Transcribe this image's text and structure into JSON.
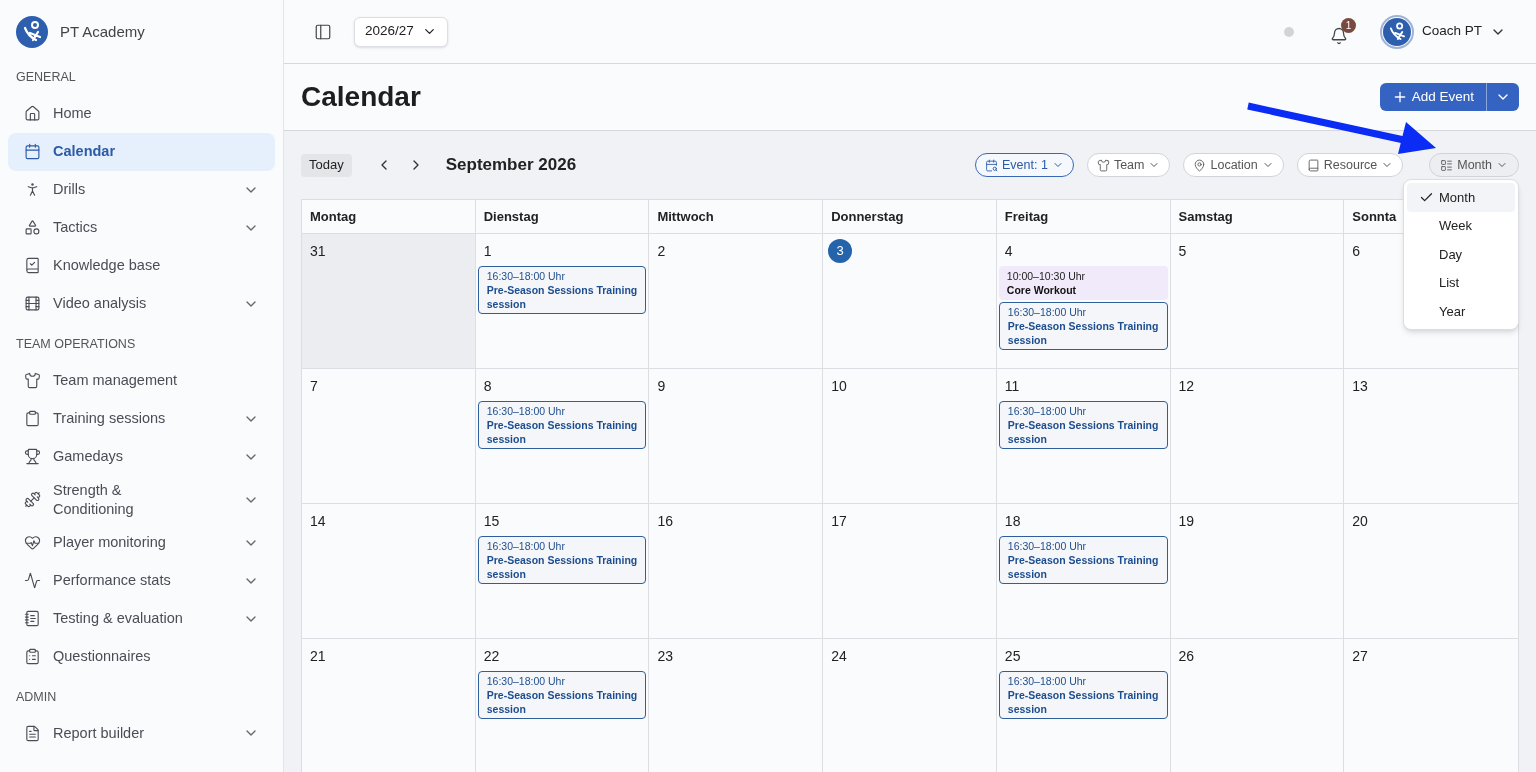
{
  "brand": {
    "name": "PT Academy"
  },
  "sidebar": {
    "sections": [
      {
        "title": "GENERAL",
        "items": [
          {
            "label": "Home",
            "selected": false,
            "expandable": false
          },
          {
            "label": "Calendar",
            "selected": true,
            "expandable": false
          },
          {
            "label": "Drills",
            "selected": false,
            "expandable": true
          },
          {
            "label": "Tactics",
            "selected": false,
            "expandable": true
          },
          {
            "label": "Knowledge base",
            "selected": false,
            "expandable": false
          },
          {
            "label": "Video analysis",
            "selected": false,
            "expandable": true
          }
        ]
      },
      {
        "title": "TEAM OPERATIONS",
        "items": [
          {
            "label": "Team management",
            "selected": false,
            "expandable": false
          },
          {
            "label": "Training sessions",
            "selected": false,
            "expandable": true
          },
          {
            "label": "Gamedays",
            "selected": false,
            "expandable": true
          },
          {
            "label": "Strength & Conditioning",
            "selected": false,
            "expandable": true
          },
          {
            "label": "Player monitoring",
            "selected": false,
            "expandable": true
          },
          {
            "label": "Performance stats",
            "selected": false,
            "expandable": true
          },
          {
            "label": "Testing & evaluation",
            "selected": false,
            "expandable": true
          },
          {
            "label": "Questionnaires",
            "selected": false,
            "expandable": false
          }
        ]
      },
      {
        "title": "ADMIN",
        "items": [
          {
            "label": "Report builder",
            "selected": false,
            "expandable": true
          }
        ]
      }
    ]
  },
  "topbar": {
    "season": "2026/27",
    "notifications": "1",
    "user": "Coach PT"
  },
  "page": {
    "title": "Calendar",
    "add_button": "Add Event"
  },
  "toolbar": {
    "today": "Today",
    "month_label": "September 2026",
    "filters": [
      {
        "label": "Event: 1",
        "active": true
      },
      {
        "label": "Team",
        "active": false
      },
      {
        "label": "Location",
        "active": false
      },
      {
        "label": "Resource",
        "active": false
      }
    ],
    "view_button": "Month",
    "view_menu": [
      {
        "label": "Month",
        "selected": true
      },
      {
        "label": "Week",
        "selected": false
      },
      {
        "label": "Day",
        "selected": false
      },
      {
        "label": "List",
        "selected": false
      },
      {
        "label": "Year",
        "selected": false
      }
    ]
  },
  "calendar": {
    "weekdays": [
      "Montag",
      "Dienstag",
      "Mittwoch",
      "Donnerstag",
      "Freitag",
      "Samstag",
      "Sonnta"
    ],
    "weeks": [
      [
        {
          "day": "31",
          "outside": true,
          "today": false
        },
        {
          "day": "1",
          "outside": false,
          "today": false,
          "events": [
            {
              "kind": "session",
              "time": "16:30–18:00 Uhr",
              "title": "Pre-Season Sessions Training session"
            }
          ]
        },
        {
          "day": "2",
          "outside": false,
          "today": false
        },
        {
          "day": "3",
          "outside": false,
          "today": true
        },
        {
          "day": "4",
          "outside": false,
          "today": false,
          "events": [
            {
              "kind": "workout",
              "time": "10:00–10:30 Uhr",
              "title": "Core Workout"
            },
            {
              "kind": "session",
              "time": "16:30–18:00 Uhr",
              "title": "Pre-Season Sessions Training session"
            }
          ]
        },
        {
          "day": "5",
          "outside": false,
          "today": false
        },
        {
          "day": "6",
          "outside": false,
          "today": false
        }
      ],
      [
        {
          "day": "7",
          "outside": false,
          "today": false
        },
        {
          "day": "8",
          "outside": false,
          "today": false,
          "events": [
            {
              "kind": "session",
              "time": "16:30–18:00 Uhr",
              "title": "Pre-Season Sessions Training session"
            }
          ]
        },
        {
          "day": "9",
          "outside": false,
          "today": false
        },
        {
          "day": "10",
          "outside": false,
          "today": false
        },
        {
          "day": "11",
          "outside": false,
          "today": false,
          "events": [
            {
              "kind": "session",
              "time": "16:30–18:00 Uhr",
              "title": "Pre-Season Sessions Training session"
            }
          ]
        },
        {
          "day": "12",
          "outside": false,
          "today": false
        },
        {
          "day": "13",
          "outside": false,
          "today": false
        }
      ],
      [
        {
          "day": "14",
          "outside": false,
          "today": false
        },
        {
          "day": "15",
          "outside": false,
          "today": false,
          "events": [
            {
              "kind": "session",
              "time": "16:30–18:00 Uhr",
              "title": "Pre-Season Sessions Training session"
            }
          ]
        },
        {
          "day": "16",
          "outside": false,
          "today": false
        },
        {
          "day": "17",
          "outside": false,
          "today": false
        },
        {
          "day": "18",
          "outside": false,
          "today": false,
          "events": [
            {
              "kind": "session",
              "time": "16:30–18:00 Uhr",
              "title": "Pre-Season Sessions Training session"
            }
          ]
        },
        {
          "day": "19",
          "outside": false,
          "today": false
        },
        {
          "day": "20",
          "outside": false,
          "today": false
        }
      ],
      [
        {
          "day": "21",
          "outside": false,
          "today": false
        },
        {
          "day": "22",
          "outside": false,
          "today": false,
          "events": [
            {
              "kind": "session",
              "time": "16:30–18:00 Uhr",
              "title": "Pre-Season Sessions Training session"
            }
          ]
        },
        {
          "day": "23",
          "outside": false,
          "today": false
        },
        {
          "day": "24",
          "outside": false,
          "today": false
        },
        {
          "day": "25",
          "outside": false,
          "today": false,
          "events": [
            {
              "kind": "session",
              "time": "16:30–18:00 Uhr",
              "title": "Pre-Season Sessions Training session"
            }
          ]
        },
        {
          "day": "26",
          "outside": false,
          "today": false
        },
        {
          "day": "27",
          "outside": false,
          "today": false
        }
      ]
    ]
  }
}
